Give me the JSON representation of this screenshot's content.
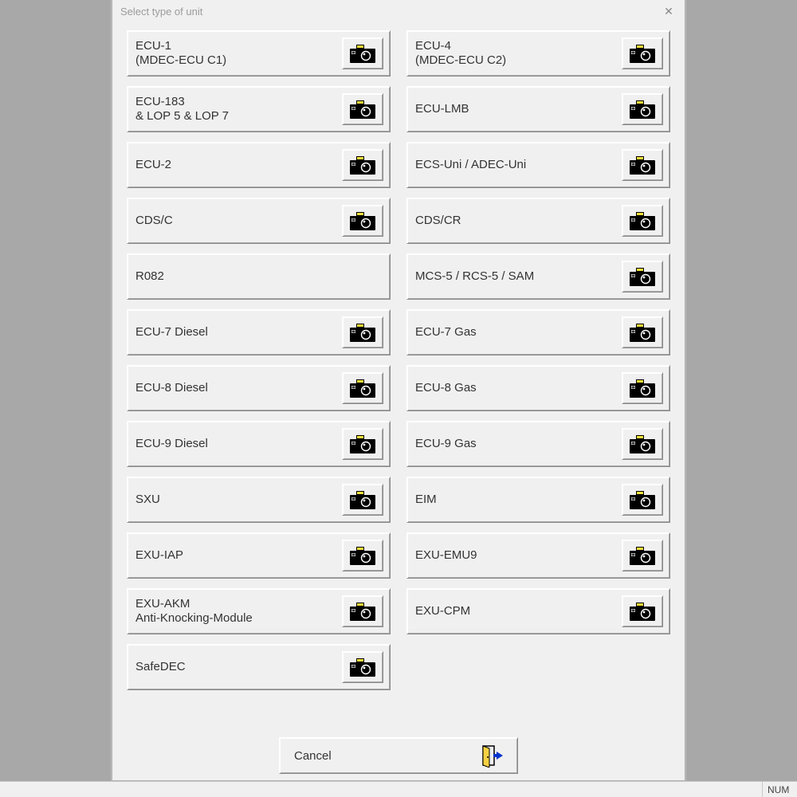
{
  "dialog": {
    "title": "Select type of unit",
    "cancel_label": "Cancel"
  },
  "statusbar": {
    "num": "NUM"
  },
  "options": [
    {
      "label": "ECU-1\n(MDEC-ECU C1)",
      "name": "option-ecu-1",
      "camera": true,
      "col": 1
    },
    {
      "label": "ECU-4\n(MDEC-ECU C2)",
      "name": "option-ecu-4",
      "camera": true,
      "col": 2
    },
    {
      "label": "ECU-183\n& LOP 5 & LOP 7",
      "name": "option-ecu-183",
      "camera": true,
      "col": 1
    },
    {
      "label": "ECU-LMB",
      "name": "option-ecu-lmb",
      "camera": true,
      "col": 2
    },
    {
      "label": "ECU-2",
      "name": "option-ecu-2",
      "camera": true,
      "col": 1
    },
    {
      "label": "ECS-Uni / ADEC-Uni",
      "name": "option-ecs-uni",
      "camera": true,
      "col": 2
    },
    {
      "label": "CDS/C",
      "name": "option-cds-c",
      "camera": true,
      "col": 1
    },
    {
      "label": "CDS/CR",
      "name": "option-cds-cr",
      "camera": true,
      "col": 2
    },
    {
      "label": "R082",
      "name": "option-r082",
      "camera": false,
      "col": 1
    },
    {
      "label": "MCS-5 / RCS-5 / SAM",
      "name": "option-mcs-5",
      "camera": true,
      "col": 2
    },
    {
      "label": "ECU-7 Diesel",
      "name": "option-ecu-7-diesel",
      "camera": true,
      "col": 1
    },
    {
      "label": "ECU-7 Gas",
      "name": "option-ecu-7-gas",
      "camera": true,
      "col": 2
    },
    {
      "label": "ECU-8 Diesel",
      "name": "option-ecu-8-diesel",
      "camera": true,
      "col": 1
    },
    {
      "label": "ECU-8 Gas",
      "name": "option-ecu-8-gas",
      "camera": true,
      "col": 2
    },
    {
      "label": "ECU-9 Diesel",
      "name": "option-ecu-9-diesel",
      "camera": true,
      "col": 1
    },
    {
      "label": "ECU-9 Gas",
      "name": "option-ecu-9-gas",
      "camera": true,
      "col": 2
    },
    {
      "label": "SXU",
      "name": "option-sxu",
      "camera": true,
      "col": 1
    },
    {
      "label": "EIM",
      "name": "option-eim",
      "camera": true,
      "col": 2
    },
    {
      "label": "EXU-IAP",
      "name": "option-exu-iap",
      "camera": true,
      "col": 1
    },
    {
      "label": "EXU-EMU9",
      "name": "option-exu-emu9",
      "camera": true,
      "col": 2
    },
    {
      "label": "EXU-AKM\nAnti-Knocking-Module",
      "name": "option-exu-akm",
      "camera": true,
      "col": 1
    },
    {
      "label": "EXU-CPM",
      "name": "option-exu-cpm",
      "camera": true,
      "col": 2
    },
    {
      "label": "SafeDEC",
      "name": "option-safedec",
      "camera": true,
      "col": 1
    }
  ]
}
